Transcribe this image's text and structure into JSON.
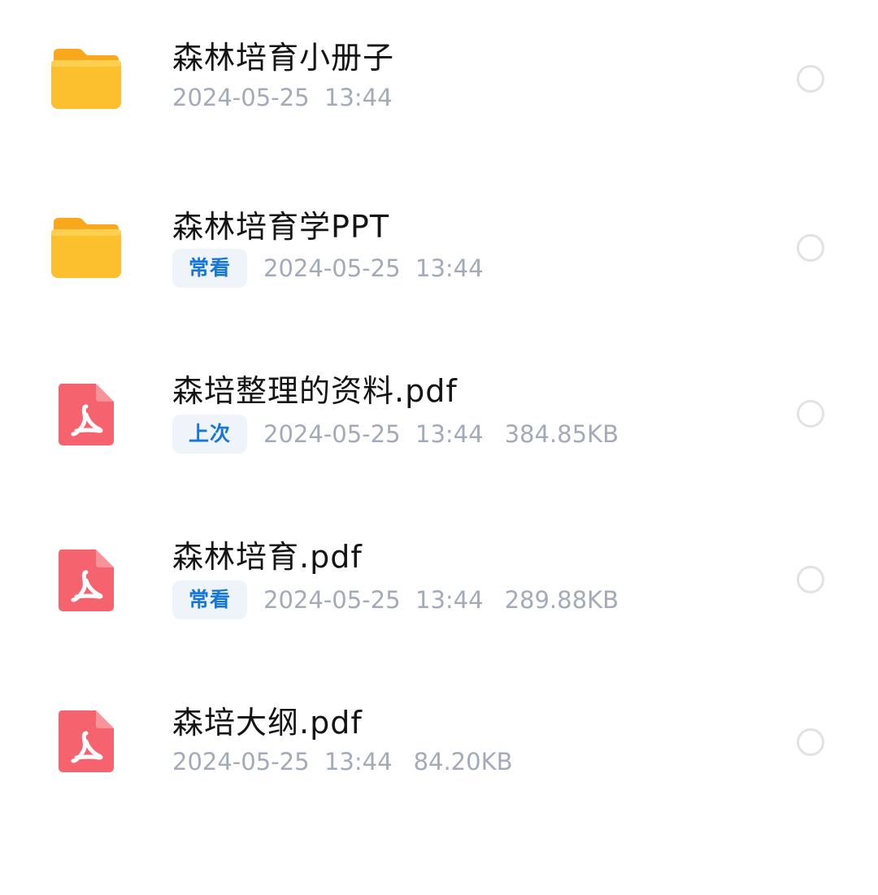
{
  "files": [
    {
      "name": "森林培育小册子",
      "type": "folder",
      "icon": "folder-icon",
      "tag": null,
      "date": "2024-05-25",
      "time": "13:44",
      "size": null
    },
    {
      "name": "森林培育学PPT",
      "type": "folder",
      "icon": "folder-icon",
      "tag": "常看",
      "date": "2024-05-25",
      "time": "13:44",
      "size": null
    },
    {
      "name": "森培整理的资料.pdf",
      "type": "pdf",
      "icon": "pdf-icon",
      "tag": "上次",
      "date": "2024-05-25",
      "time": "13:44",
      "size": "384.85KB"
    },
    {
      "name": "森林培育.pdf",
      "type": "pdf",
      "icon": "pdf-icon",
      "tag": "常看",
      "date": "2024-05-25",
      "time": "13:44",
      "size": "289.88KB"
    },
    {
      "name": "森培大纲.pdf",
      "type": "pdf",
      "icon": "pdf-icon",
      "tag": null,
      "date": "2024-05-25",
      "time": "13:44",
      "size": "84.20KB"
    }
  ],
  "colors": {
    "folder": "#fcc02e",
    "pdf": "#f5636e",
    "tag_text": "#1677d8",
    "tag_bg": "#eff4fb",
    "meta_text": "#a3aab8"
  }
}
